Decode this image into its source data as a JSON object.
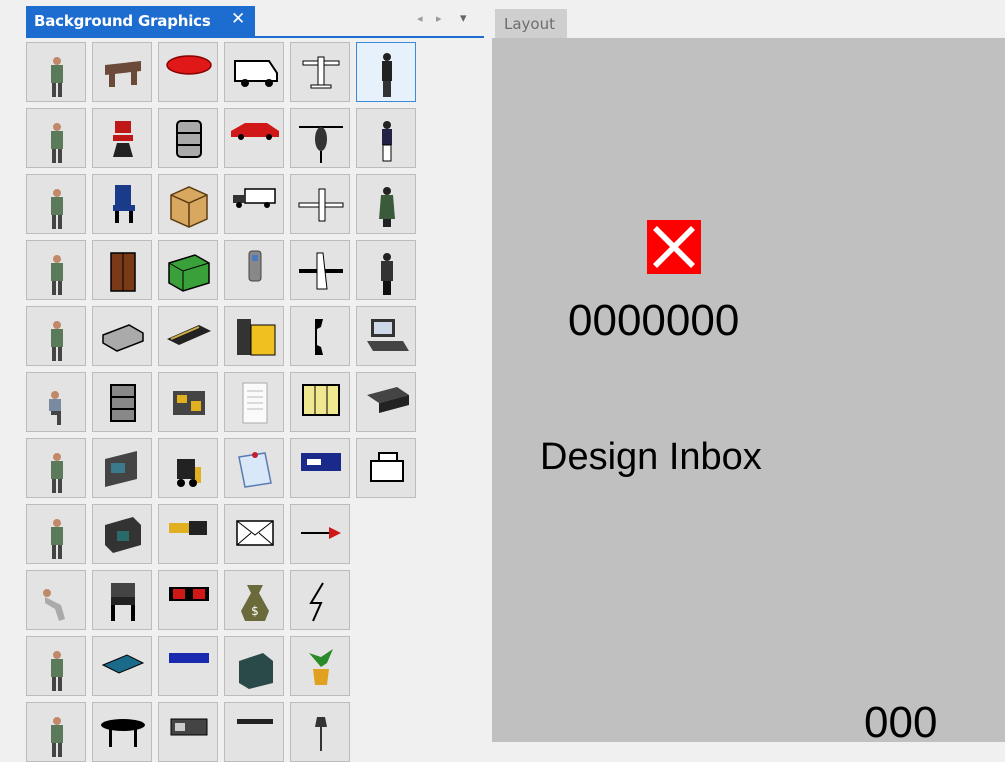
{
  "left_panel": {
    "tab_title": "Background Graphics",
    "close_glyph": "✕",
    "nav_prev_glyph": "◂",
    "nav_next_glyph": "▸",
    "dropdown_glyph": "▾",
    "accent_color": "#1c6dcf"
  },
  "graphics": [
    [
      "person-icon",
      "desk-icon",
      "red-pad-icon",
      "van-icon",
      "small-plane-icon",
      "walking-person-icon"
    ],
    [
      "person-icon",
      "red-chair-icon",
      "barrel-icon",
      "red-car-icon",
      "helicopter-icon",
      "standing-person-icon"
    ],
    [
      "person-icon",
      "blue-chair-icon",
      "box-icon",
      "truck-icon",
      "airplane-icon",
      "woman-icon"
    ],
    [
      "person-icon",
      "cabinet-icon",
      "container-icon",
      "phone-handset-icon",
      "jet-icon",
      "worker-icon"
    ],
    [
      "person-icon",
      "brick-icon",
      "conveyor-icon",
      "desk-phone-icon",
      "phone-receiver-icon",
      "computer-icon"
    ],
    [
      "seated-person-icon",
      "shelves-icon",
      "machine-icon",
      "document-icon",
      "map-icon",
      "printer-icon"
    ],
    [
      "person-icon",
      "workstation-icon",
      "forklift-icon",
      "clipboard-icon",
      "sign-icon",
      "fax-icon"
    ],
    [
      "person-icon",
      "cubicle-icon",
      "plug-icon",
      "envelope-icon",
      "arrow-icon"
    ],
    [
      "crouching-person-icon",
      "chair-icon",
      "battery-icon",
      "money-bag-icon",
      "lightning-icon"
    ],
    [
      "person-icon",
      "tray-icon",
      "pallet-icon",
      "luggage-icon",
      "plant-icon"
    ],
    [
      "person-icon",
      "table-icon",
      "rack-icon",
      "bar-icon",
      "lamp-icon"
    ]
  ],
  "layout_panel": {
    "tab_label": "Layout",
    "error_icon": "error-x-icon",
    "counter_text": "0000000",
    "inbox_label": "Design Inbox",
    "bottom_counter": "000",
    "canvas_color": "#c0c0c0"
  }
}
